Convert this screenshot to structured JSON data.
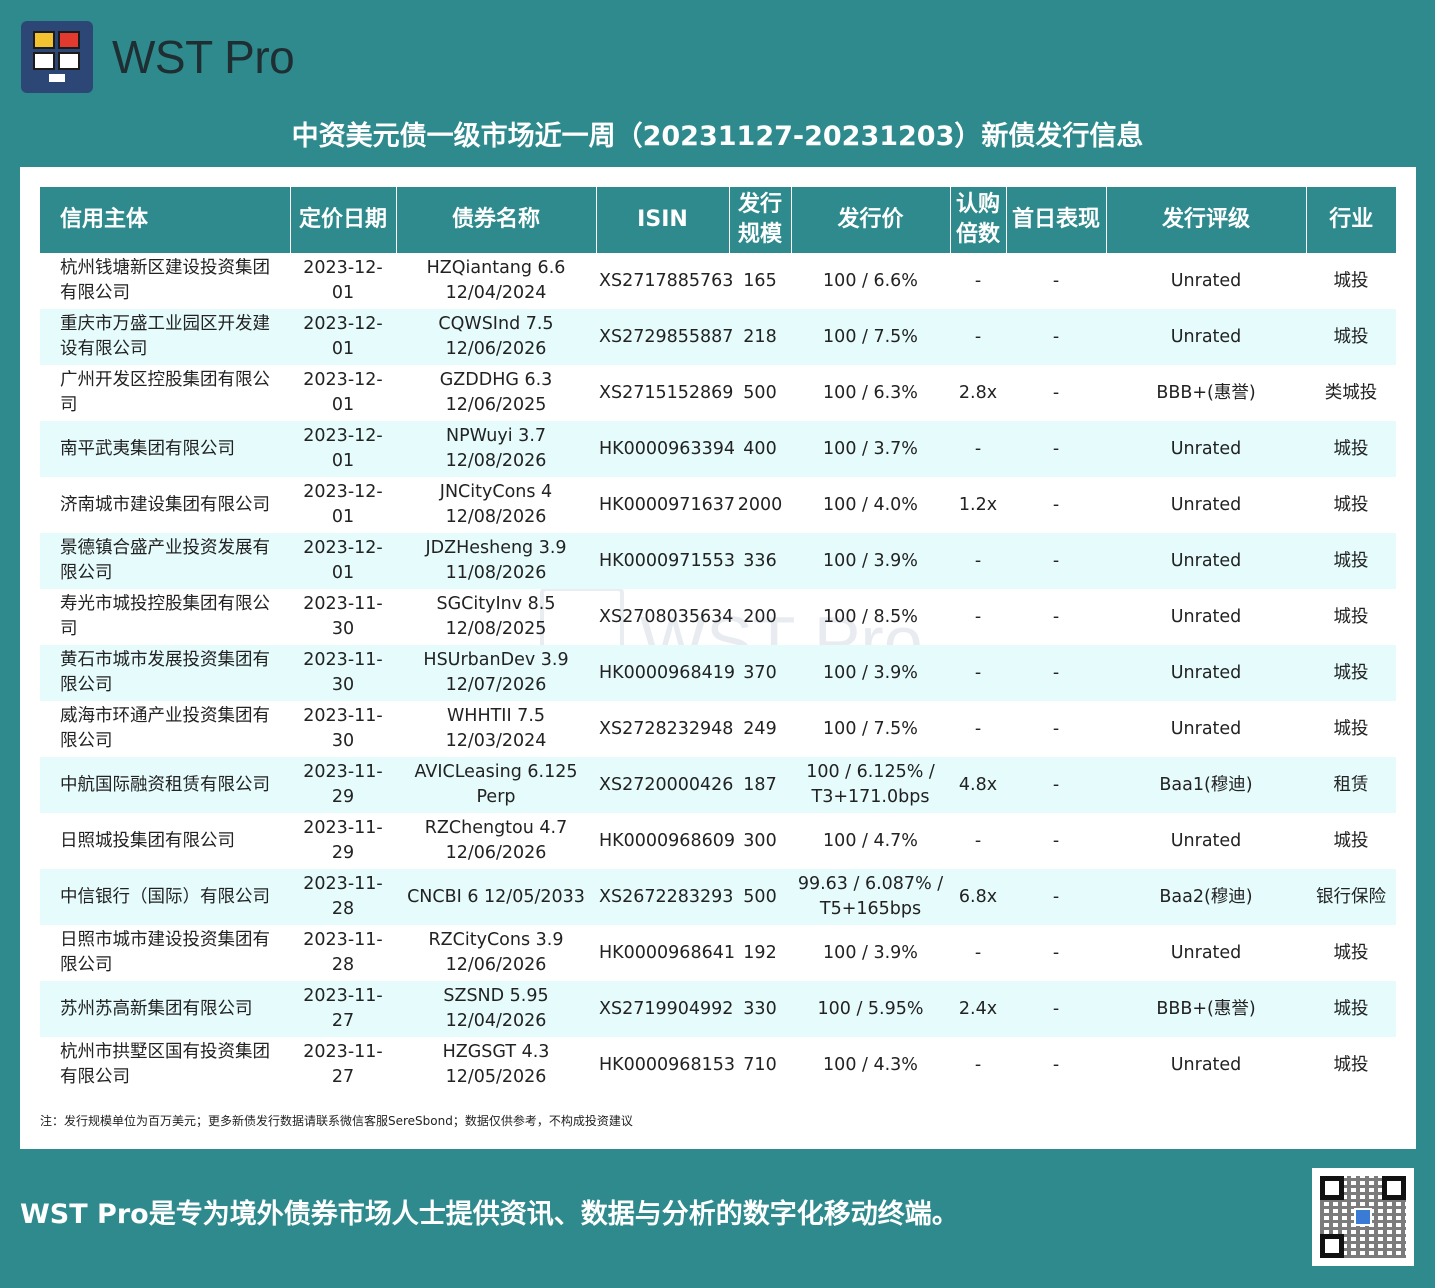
{
  "header": {
    "brand": "WST Pro",
    "title": "中资美元债一级市场近一周（20231127-20231203）新债发行信息"
  },
  "watermark": "WST Pro",
  "table": {
    "columns": [
      "信用主体",
      "定价日期",
      "债券名称",
      "ISIN",
      "发行\n规模",
      "发行价",
      "认购\n倍数",
      "首日表现",
      "发行评级",
      "行业"
    ],
    "rows": [
      [
        "杭州钱塘新区建设投资集团有限公司",
        "2023-12-01",
        "HZQiantang 6.6 12/04/2024",
        "XS2717885763",
        "165",
        "100 / 6.6%",
        "-",
        "-",
        "Unrated",
        "城投"
      ],
      [
        "重庆市万盛工业园区开发建设有限公司",
        "2023-12-01",
        "CQWSInd 7.5 12/06/2026",
        "XS2729855887",
        "218",
        "100 / 7.5%",
        "-",
        "-",
        "Unrated",
        "城投"
      ],
      [
        "广州开发区控股集团有限公司",
        "2023-12-01",
        "GZDDHG 6.3 12/06/2025",
        "XS2715152869",
        "500",
        "100 / 6.3%",
        "2.8x",
        "-",
        "BBB+(惠誉)",
        "类城投"
      ],
      [
        "南平武夷集团有限公司",
        "2023-12-01",
        "NPWuyi 3.7 12/08/2026",
        "HK0000963394",
        "400",
        "100 / 3.7%",
        "-",
        "-",
        "Unrated",
        "城投"
      ],
      [
        "济南城市建设集团有限公司",
        "2023-12-01",
        "JNCityCons 4 12/08/2026",
        "HK0000971637",
        "2000",
        "100 / 4.0%",
        "1.2x",
        "-",
        "Unrated",
        "城投"
      ],
      [
        "景德镇合盛产业投资发展有限公司",
        "2023-12-01",
        "JDZHesheng 3.9 11/08/2026",
        "HK0000971553",
        "336",
        "100 / 3.9%",
        "-",
        "-",
        "Unrated",
        "城投"
      ],
      [
        "寿光市城投控股集团有限公司",
        "2023-11-30",
        "SGCityInv 8.5 12/08/2025",
        "XS2708035634",
        "200",
        "100 / 8.5%",
        "-",
        "-",
        "Unrated",
        "城投"
      ],
      [
        "黄石市城市发展投资集团有限公司",
        "2023-11-30",
        "HSUrbanDev 3.9 12/07/2026",
        "HK0000968419",
        "370",
        "100 / 3.9%",
        "-",
        "-",
        "Unrated",
        "城投"
      ],
      [
        "威海市环通产业投资集团有限公司",
        "2023-11-30",
        "WHHTII 7.5 12/03/2024",
        "XS2728232948",
        "249",
        "100 / 7.5%",
        "-",
        "-",
        "Unrated",
        "城投"
      ],
      [
        "中航国际融资租赁有限公司",
        "2023-11-29",
        "AVICLeasing 6.125 Perp",
        "XS2720000426",
        "187",
        "100 / 6.125% / T3+171.0bps",
        "4.8x",
        "-",
        "Baa1(穆迪)",
        "租赁"
      ],
      [
        "日照城投集团有限公司",
        "2023-11-29",
        "RZChengtou 4.7 12/06/2026",
        "HK0000968609",
        "300",
        "100 / 4.7%",
        "-",
        "-",
        "Unrated",
        "城投"
      ],
      [
        "中信银行（国际）有限公司",
        "2023-11-28",
        "CNCBI 6 12/05/2033",
        "XS2672283293",
        "500",
        "99.63 / 6.087% / T5+165bps",
        "6.8x",
        "-",
        "Baa2(穆迪)",
        "银行保险"
      ],
      [
        "日照市城市建设投资集团有限公司",
        "2023-11-28",
        "RZCityCons 3.9 12/06/2026",
        "HK0000968641",
        "192",
        "100 / 3.9%",
        "-",
        "-",
        "Unrated",
        "城投"
      ],
      [
        "苏州苏高新集团有限公司",
        "2023-11-27",
        "SZSND 5.95 12/04/2026",
        "XS2719904992",
        "330",
        "100 / 5.95%",
        "2.4x",
        "-",
        "BBB+(惠誉)",
        "城投"
      ],
      [
        "杭州市拱墅区国有投资集团有限公司",
        "2023-11-27",
        "HZGSGT 4.3 12/05/2026",
        "HK0000968153",
        "710",
        "100 / 4.3%",
        "-",
        "-",
        "Unrated",
        "城投"
      ]
    ]
  },
  "note": "注：发行规模单位为百万美元；更多新债发行数据请联系微信客服SereSbond；数据仅供参考，不构成投资建议",
  "footer": "WST Pro是专为境外债券市场人士提供资讯、数据与分析的数字化移动终端。"
}
